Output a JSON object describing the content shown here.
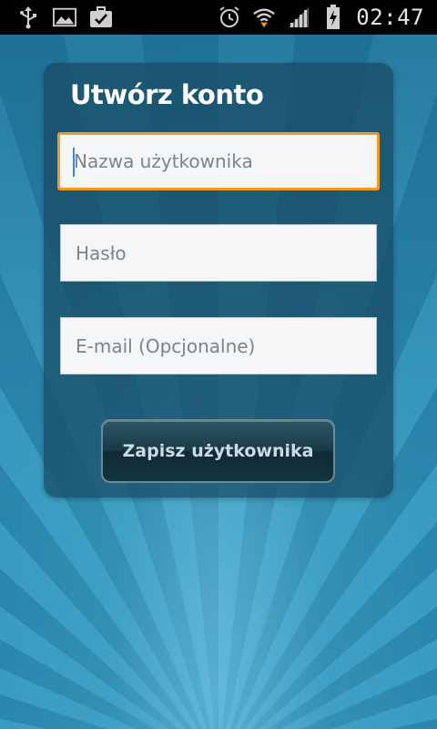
{
  "status_bar": {
    "time": "02:47",
    "left_icons": [
      "usb-icon",
      "image-icon",
      "briefcase-check-icon"
    ],
    "right_icons": [
      "alarm-icon",
      "wifi-icon",
      "signal-icon",
      "battery-charging-icon"
    ]
  },
  "form": {
    "title": "Utwórz konto",
    "username_placeholder": "Nazwa użytkownika",
    "password_placeholder": "Hasło",
    "email_placeholder": "E-mail (Opcjonalne)",
    "save_label": "Zapisz użytkownika"
  },
  "colors": {
    "focus_border": "#f29a1d",
    "background": "#2f8fb3",
    "card": "#184a62"
  }
}
